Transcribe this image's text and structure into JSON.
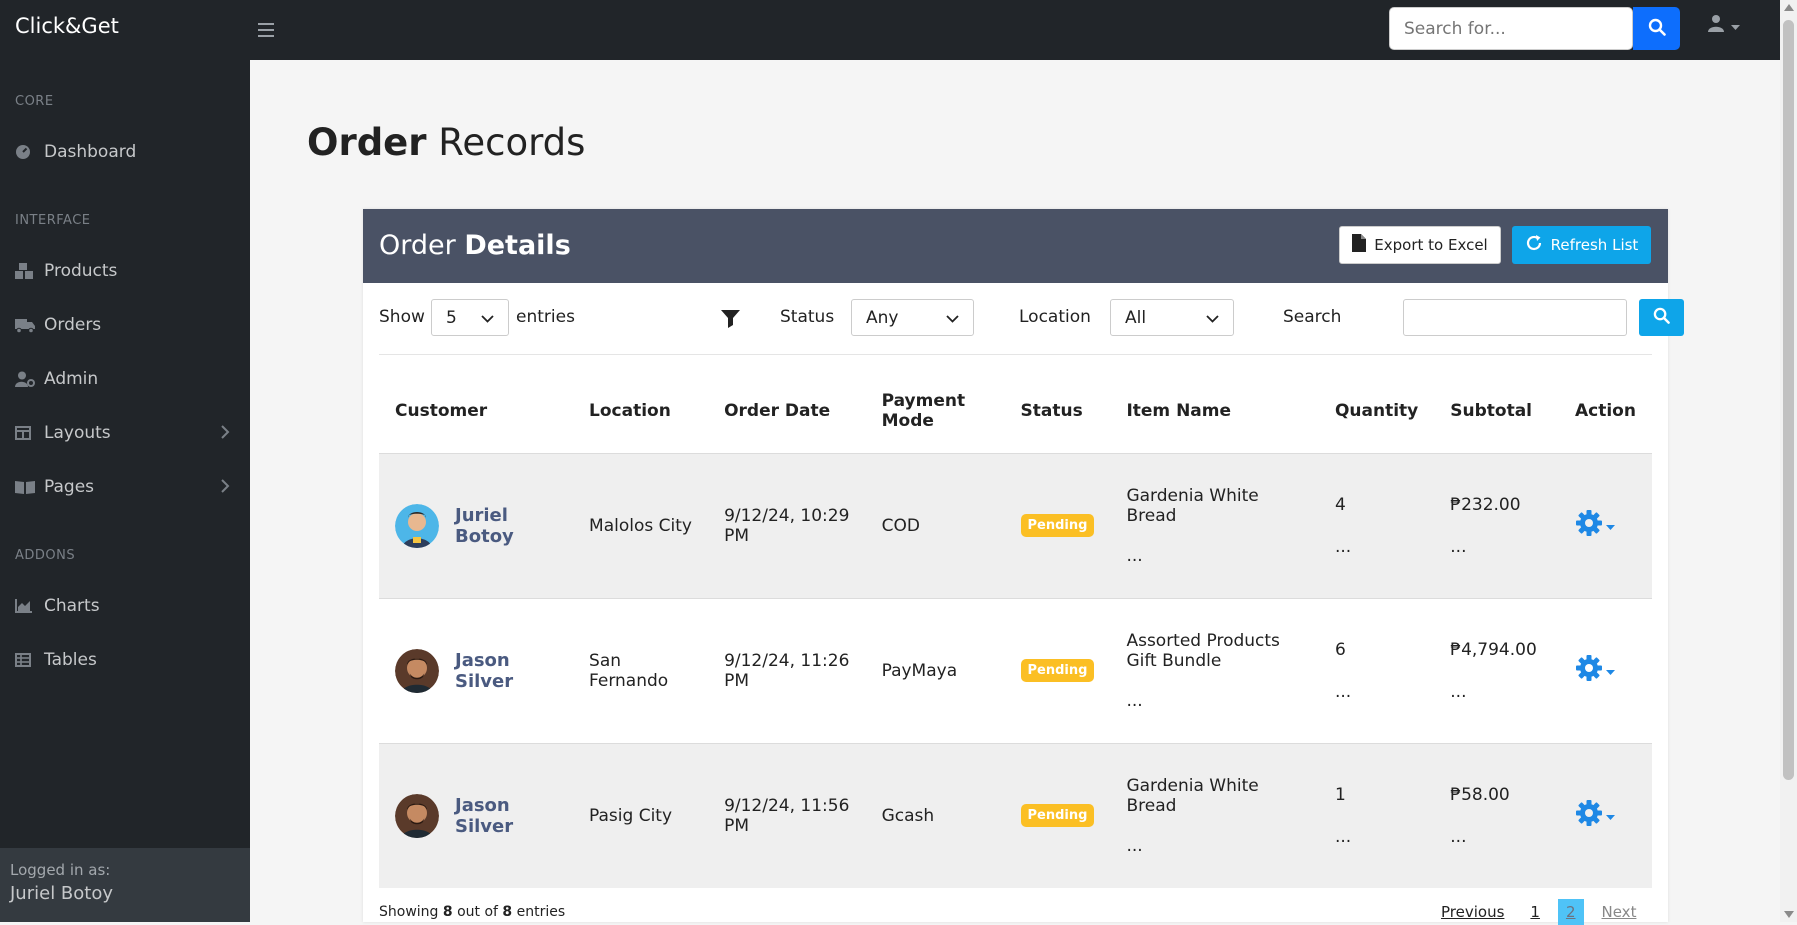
{
  "app": {
    "brand": "Click&Get"
  },
  "topbar": {
    "search_placeholder": "Search for..."
  },
  "sidebar": {
    "sections": [
      {
        "heading": "CORE"
      },
      {
        "heading": "INTERFACE"
      },
      {
        "heading": "ADDONS"
      }
    ],
    "items": [
      {
        "label": "Dashboard",
        "icon": "dashboard-icon"
      },
      {
        "label": "Products",
        "icon": "boxes-icon"
      },
      {
        "label": "Orders",
        "icon": "truck-icon"
      },
      {
        "label": "Admin",
        "icon": "user-gear-icon"
      },
      {
        "label": "Layouts",
        "icon": "columns-icon"
      },
      {
        "label": "Pages",
        "icon": "book-open-icon"
      },
      {
        "label": "Charts",
        "icon": "chart-area-icon"
      },
      {
        "label": "Tables",
        "icon": "table-icon"
      }
    ],
    "footer": {
      "label": "Logged in as:",
      "user": "Juriel Botoy"
    }
  },
  "page": {
    "title_bold": "Order",
    "title_rest": "Records"
  },
  "card": {
    "title_light": "Order",
    "title_bold": "Details",
    "export_label": "Export to Excel",
    "refresh_label": "Refresh List"
  },
  "filters": {
    "show_label": "Show",
    "show_value": "5",
    "entries_label": "entries",
    "status_label": "Status",
    "status_value": "Any",
    "location_label": "Location",
    "location_value": "All",
    "search_label": "Search"
  },
  "table": {
    "headers": [
      "Customer",
      "Location",
      "Order Date",
      "Payment Mode",
      "Status",
      "Item Name",
      "Quantity",
      "Subtotal",
      "Action"
    ],
    "rows": [
      {
        "customer": "Juriel Botoy",
        "location": "Malolos City",
        "date": "9/12/24, 10:29 PM",
        "payment": "COD",
        "status": "Pending",
        "item": "Gardenia White Bread",
        "item_more": "...",
        "qty": "4",
        "qty_more": "...",
        "subtotal": "₱232.00",
        "subtotal_more": "..."
      },
      {
        "customer": "Jason Silver",
        "location": "San Fernando",
        "date": "9/12/24, 11:26 PM",
        "payment": "PayMaya",
        "status": "Pending",
        "item": "Assorted Products Gift Bundle",
        "item_more": "...",
        "qty": "6",
        "qty_more": "...",
        "subtotal": "₱4,794.00",
        "subtotal_more": "..."
      },
      {
        "customer": "Jason Silver",
        "location": "Pasig City",
        "date": "9/12/24, 11:56 PM",
        "payment": "Gcash",
        "status": "Pending",
        "item": "Gardenia White Bread",
        "item_more": "...",
        "qty": "1",
        "qty_more": "...",
        "subtotal": "₱58.00",
        "subtotal_more": "..."
      }
    ]
  },
  "footer": {
    "showing_prefix": "Showing",
    "showing_count": "8",
    "showing_mid": "out of",
    "showing_total": "8",
    "showing_suffix": "entries"
  },
  "pagination": {
    "previous": "Previous",
    "page1": "1",
    "page2": "2",
    "next": "Next"
  },
  "colors": {
    "accent": "#0d6efd",
    "refresh": "#0ea5e9",
    "badge": "#fbbf24",
    "card_header": "#4a5265"
  }
}
